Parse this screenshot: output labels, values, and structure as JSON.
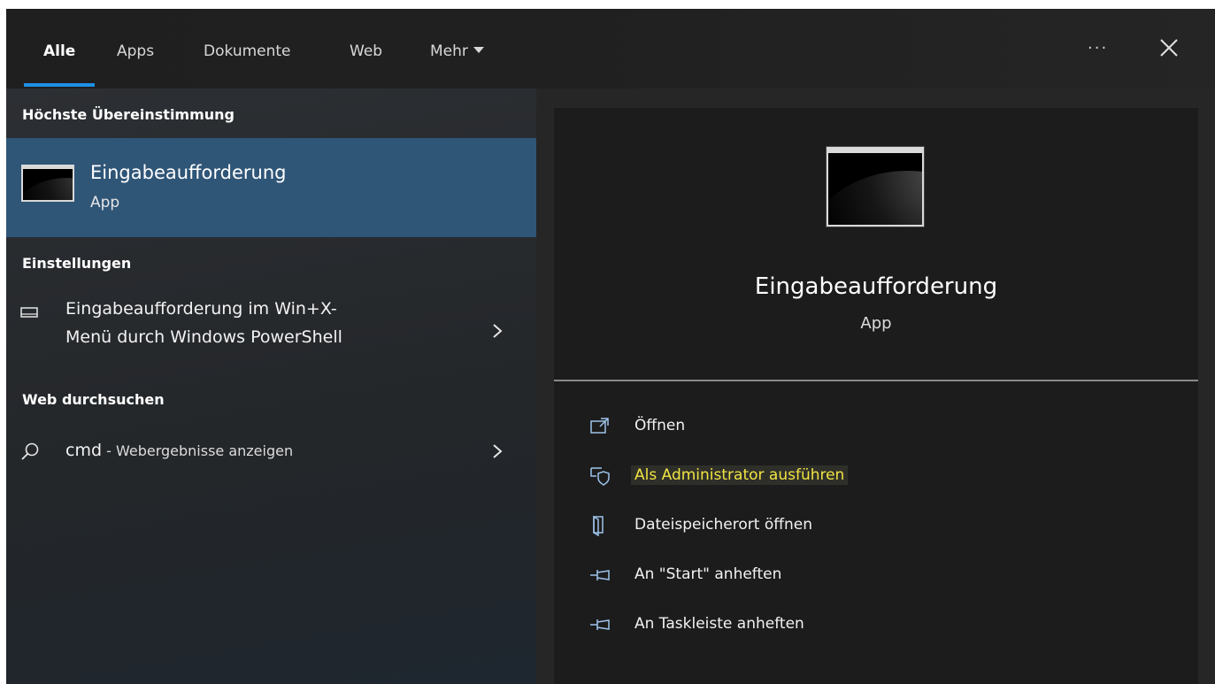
{
  "tabs": [
    {
      "label": "Alle",
      "active": true
    },
    {
      "label": "Apps",
      "active": false
    },
    {
      "label": "Dokumente",
      "active": false
    },
    {
      "label": "Web",
      "active": false
    },
    {
      "label": "Mehr",
      "active": false
    }
  ],
  "toolbar": {
    "more_icon": "ellipsis-icon",
    "more_label": "···",
    "close_icon": "close-icon"
  },
  "left": {
    "best_match_heading": "Höchste Übereinstimmung",
    "best_match": {
      "title": "Eingabeaufforderung",
      "subtitle": "App",
      "icon": "cmd-icon"
    },
    "settings_heading": "Einstellungen",
    "settings_item": {
      "line1": "Eingabeaufforderung im Win+X-",
      "line2": "Menü durch Windows PowerShell",
      "icon": "display-icon"
    },
    "web_heading": "Web durchsuchen",
    "web_item": {
      "query": "cmd",
      "suffix": " - Webergebnisse anzeigen",
      "icon": "search-icon"
    }
  },
  "right": {
    "title": "Eingabeaufforderung",
    "subtitle": "App",
    "actions": [
      {
        "label": "Öffnen",
        "icon": "open-icon",
        "highlight": false
      },
      {
        "label": "Als Administrator ausführen",
        "icon": "shield-icon",
        "highlight": true
      },
      {
        "label": "Dateispeicherort öffnen",
        "icon": "folder-icon",
        "highlight": false
      },
      {
        "label": "An \"Start\" anheften",
        "icon": "pin-icon",
        "highlight": false
      },
      {
        "label": "An Taskleiste anheften",
        "icon": "pin-icon",
        "highlight": false
      }
    ]
  },
  "colors": {
    "accent": "#1e90e6",
    "selected_row": "#2f5577",
    "highlight_text": "#f0e442",
    "icon_blue": "#9fc4ec"
  }
}
